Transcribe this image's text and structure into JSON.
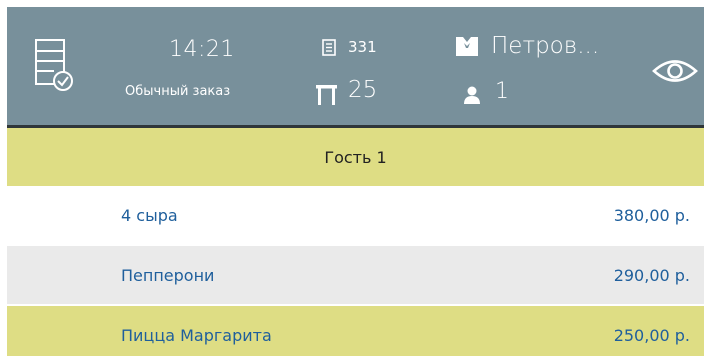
{
  "header": {
    "time": "14:21",
    "order_type": "Обычный заказ",
    "order_number": "331",
    "table_number": "25",
    "waiter_name": "Петров...",
    "guest_count": "1",
    "background_color": "#78909b",
    "icons": [
      "order-check-icon",
      "receipt-icon",
      "table-icon",
      "waiter-icon",
      "person-icon",
      "eye-icon"
    ]
  },
  "guest_section": {
    "label": "Гость 1",
    "background_color": "#dedd84"
  },
  "items": [
    {
      "name": "4 сыра",
      "price": "380,00 р.",
      "background": "#ffffff"
    },
    {
      "name": "Пепперони",
      "price": "290,00 р.",
      "background": "#eaeaea"
    },
    {
      "name": "Пицца Маргарита",
      "price": "250,00 р.",
      "background": "#dedd84"
    }
  ]
}
